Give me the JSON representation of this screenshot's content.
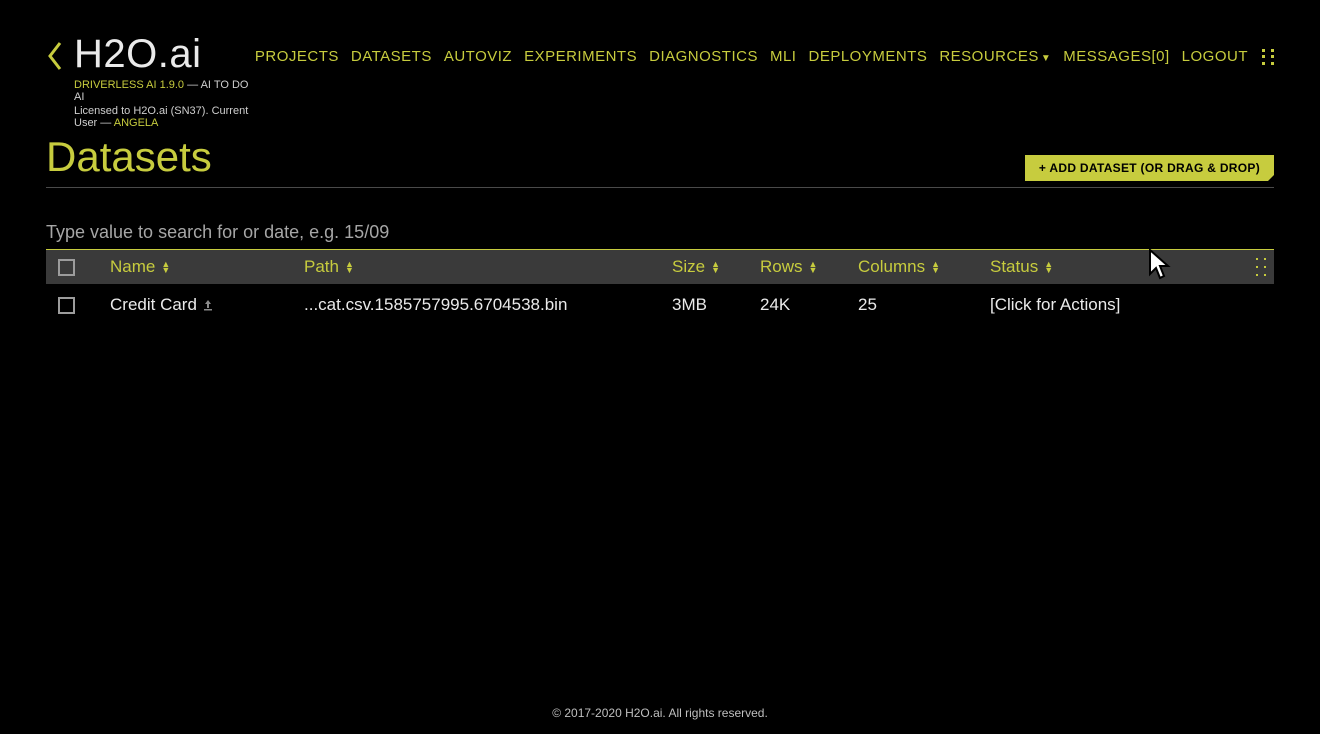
{
  "brand": {
    "title": "H2O.ai",
    "subline1_left": "DRIVERLESS AI 1.9.0",
    "subline1_right": " — AI TO DO AI",
    "subline2_prefix": "Licensed to H2O.ai (SN37). Current User — ",
    "current_user": "ANGELA"
  },
  "nav": {
    "projects": "PROJECTS",
    "datasets": "DATASETS",
    "autoviz": "AUTOVIZ",
    "experiments": "EXPERIMENTS",
    "diagnostics": "DIAGNOSTICS",
    "mli": "MLI",
    "deployments": "DEPLOYMENTS",
    "resources": "RESOURCES",
    "messages": "MESSAGES[0]",
    "logout": "LOGOUT"
  },
  "page": {
    "title": "Datasets",
    "add_button": "+ ADD DATASET (OR DRAG & DROP)"
  },
  "search": {
    "placeholder": "Type value to search for or date, e.g. 15/09"
  },
  "table": {
    "headers": {
      "name": "Name",
      "path": "Path",
      "size": "Size",
      "rows": "Rows",
      "columns": "Columns",
      "status": "Status"
    },
    "rows": [
      {
        "name": "Credit Card",
        "path": "...cat.csv.1585757995.6704538.bin",
        "size": "3MB",
        "rows": "24K",
        "columns": "25",
        "status": "[Click for Actions]"
      }
    ]
  },
  "footer": {
    "copyright": "© 2017-2020 H2O.ai. All rights reserved."
  }
}
